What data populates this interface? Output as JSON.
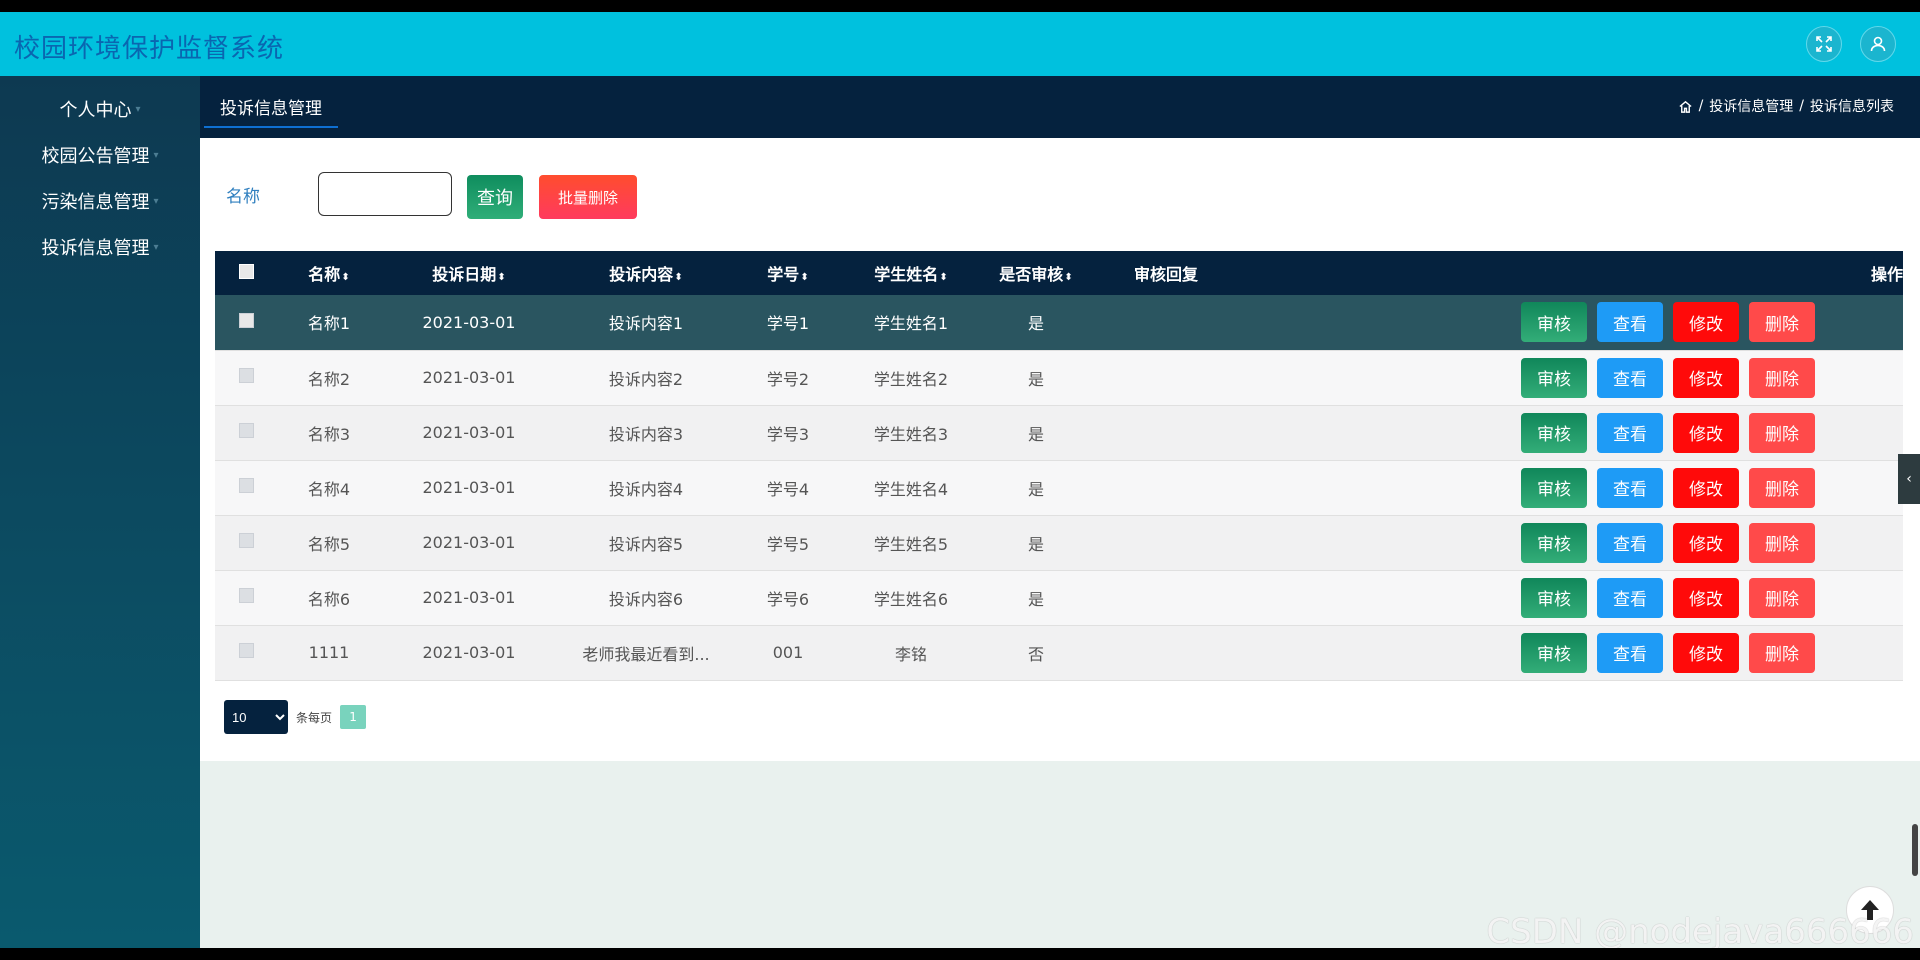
{
  "app": {
    "title": "校园环境保护监督系统"
  },
  "sidebar": {
    "items": [
      {
        "label": "个人中心"
      },
      {
        "label": "校园公告管理"
      },
      {
        "label": "污染信息管理"
      },
      {
        "label": "投诉信息管理"
      }
    ]
  },
  "tabs": {
    "active": "投诉信息管理"
  },
  "breadcrumb": {
    "items": [
      "投诉信息管理",
      "投诉信息列表"
    ],
    "separator": "/"
  },
  "search": {
    "label": "名称",
    "value": "",
    "query_label": "查询",
    "batch_delete_label": "批量删除"
  },
  "table": {
    "headers": [
      "名称",
      "投诉日期",
      "投诉内容",
      "学号",
      "学生姓名",
      "是否审核",
      "审核回复",
      "操作"
    ],
    "sort_icon": "⬍",
    "rows": [
      {
        "name": "名称1",
        "date": "2021-03-01",
        "content": "投诉内容1",
        "student_id": "学号1",
        "student_name": "学生姓名1",
        "reviewed": "是",
        "reply": ""
      },
      {
        "name": "名称2",
        "date": "2021-03-01",
        "content": "投诉内容2",
        "student_id": "学号2",
        "student_name": "学生姓名2",
        "reviewed": "是",
        "reply": ""
      },
      {
        "name": "名称3",
        "date": "2021-03-01",
        "content": "投诉内容3",
        "student_id": "学号3",
        "student_name": "学生姓名3",
        "reviewed": "是",
        "reply": ""
      },
      {
        "name": "名称4",
        "date": "2021-03-01",
        "content": "投诉内容4",
        "student_id": "学号4",
        "student_name": "学生姓名4",
        "reviewed": "是",
        "reply": ""
      },
      {
        "name": "名称5",
        "date": "2021-03-01",
        "content": "投诉内容5",
        "student_id": "学号5",
        "student_name": "学生姓名5",
        "reviewed": "是",
        "reply": ""
      },
      {
        "name": "名称6",
        "date": "2021-03-01",
        "content": "投诉内容6",
        "student_id": "学号6",
        "student_name": "学生姓名6",
        "reviewed": "是",
        "reply": ""
      },
      {
        "name": "1111",
        "date": "2021-03-01",
        "content": "老师我最近看到...",
        "student_id": "001",
        "student_name": "李铭",
        "reviewed": "否",
        "reply": ""
      }
    ],
    "row_actions": {
      "audit": "审核",
      "view": "查看",
      "edit": "修改",
      "delete": "删除"
    }
  },
  "pagination": {
    "page_size": "10",
    "per_page_label": "条每页",
    "current_page": "1"
  },
  "watermark": "CSDN @nodejava666666",
  "colors": {
    "topbar": "#00c1de",
    "title": "#0a66b0",
    "header_dark": "#05223e",
    "audit": "#10875a",
    "view": "#1e9bf6",
    "edit": "#ff0a0a",
    "delete": "#ff4a4a",
    "page_active": "#79d3bd"
  },
  "icons": {
    "fullscreen": "expand-icon",
    "user": "user-icon",
    "home": "home-icon",
    "collapse": "chevron-left-icon",
    "back_to_top": "arrow-up-icon"
  }
}
